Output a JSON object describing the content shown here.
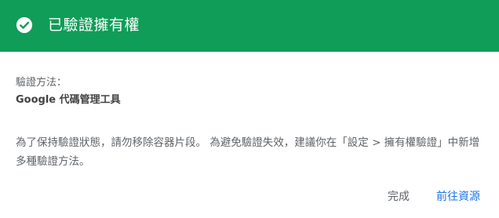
{
  "header": {
    "title": "已驗證擁有權",
    "icon": "check-circle-icon",
    "color": "#0f9d58"
  },
  "method": {
    "label": "驗證方法：",
    "value": "Google 代碼管理工具"
  },
  "notice": "為了保持驗證狀態，請勿移除容器片段。 為避免驗證失效，建議你在「設定 > 擁有權驗證」中新增多種驗證方法。",
  "actions": {
    "done_label": "完成",
    "go_label": "前往資源",
    "go_color": "#1a73e8"
  }
}
